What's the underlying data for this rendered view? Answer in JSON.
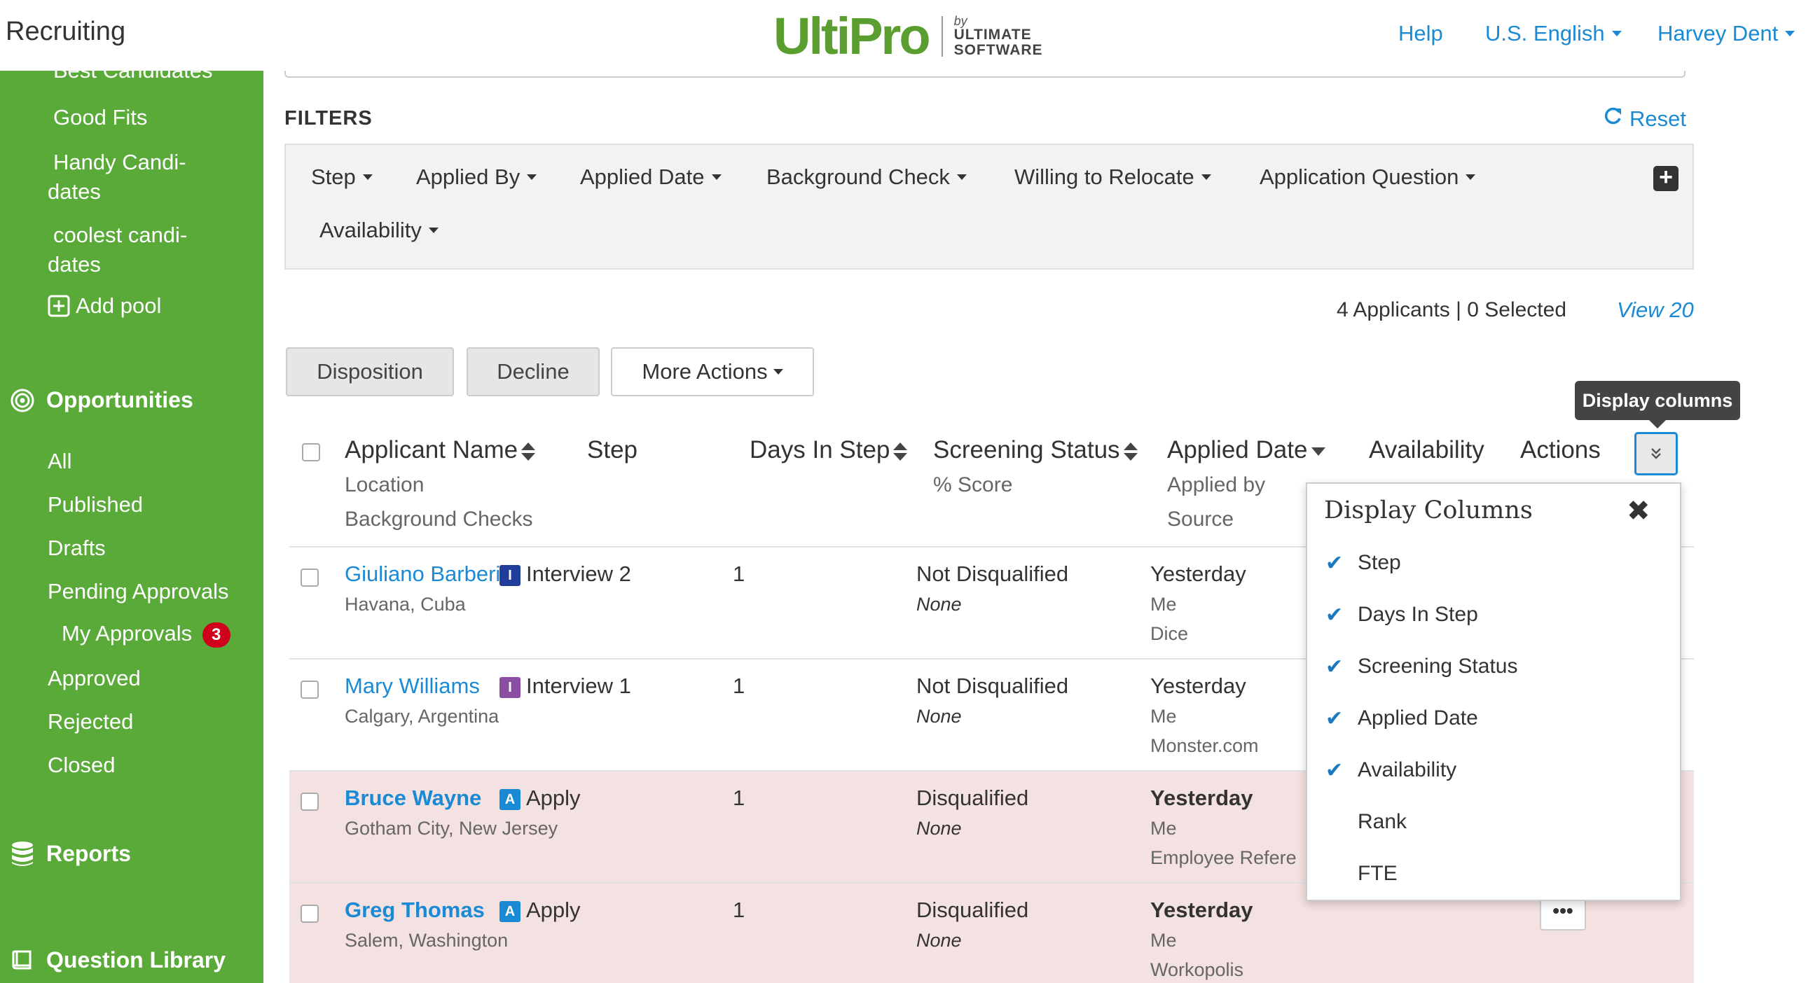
{
  "header": {
    "app_title": "Recruiting",
    "logo_main": "UltiPro",
    "logo_by": "by",
    "logo_company_line1": "ULTIMATE",
    "logo_company_line2": "SOFTWARE",
    "help": "Help",
    "language": "U.S. English",
    "user": "Harvey Dent"
  },
  "sidebar": {
    "pools": [
      {
        "label": "Best Candidates"
      },
      {
        "label": "Good Fits"
      },
      {
        "label_line1": "Handy Candi-",
        "label_line2": "dates"
      },
      {
        "label_line1": "coolest candi-",
        "label_line2": "dates"
      }
    ],
    "add_pool": "Add pool",
    "opportunities_heading": "Opportunities",
    "opportunities": [
      "All",
      "Published",
      "Drafts",
      "Pending Approvals",
      "My Approvals",
      "Approved",
      "Rejected",
      "Closed"
    ],
    "my_approvals_count": "3",
    "reports_heading": "Reports",
    "question_library_heading": "Question Library"
  },
  "filters": {
    "label": "FILTERS",
    "reset": "Reset",
    "items": [
      "Step",
      "Applied By",
      "Applied Date",
      "Background Check",
      "Willing to Relocate",
      "Application Question",
      "Availability"
    ]
  },
  "summary": {
    "count_text": "4 Applicants | 0 Selected",
    "view": "View 20"
  },
  "actions": {
    "disposition": "Disposition",
    "decline": "Decline",
    "more_actions": "More Actions"
  },
  "tooltip": "Display columns",
  "table": {
    "headers": {
      "applicant_name": "Applicant Name",
      "location": "Location",
      "background_checks": "Background Checks",
      "step": "Step",
      "days_in_step": "Days In Step",
      "screening_status": "Screening Status",
      "score": "% Score",
      "applied_date": "Applied Date",
      "applied_by": "Applied by",
      "source": "Source",
      "availability": "Availability",
      "actions": "Actions"
    },
    "rows": [
      {
        "name": "Giuliano Barberi",
        "location": "Havana, Cuba",
        "step_icon": "I",
        "step": "Interview 2",
        "days": "1",
        "status": "Not Disqualified",
        "score": "None",
        "date": "Yesterday",
        "by": "Me",
        "source": "Dice"
      },
      {
        "name": "Mary Williams",
        "location": "Calgary, Argentina",
        "step_icon": "I",
        "step": "Interview 1",
        "days": "1",
        "status": "Not Disqualified",
        "score": "None",
        "date": "Yesterday",
        "by": "Me",
        "source": "Monster.com"
      },
      {
        "name": "Bruce Wayne",
        "location": "Gotham City, New Jersey",
        "step_icon": "A",
        "step": "Apply",
        "days": "1",
        "status": "Disqualified",
        "score": "None",
        "date": "Yesterday",
        "by": "Me",
        "source": "Employee Refere"
      },
      {
        "name": "Greg Thomas",
        "location": "Salem, Washington",
        "step_icon": "A",
        "step": "Apply",
        "days": "1",
        "status": "Disqualified",
        "score": "None",
        "date": "Yesterday",
        "by": "Me",
        "source": "Workopolis"
      }
    ],
    "more_button": "•••"
  },
  "display_columns": {
    "title": "Display Columns",
    "close": "✖",
    "items": [
      {
        "label": "Step",
        "checked": true
      },
      {
        "label": "Days In Step",
        "checked": true
      },
      {
        "label": "Screening Status",
        "checked": true
      },
      {
        "label": "Applied Date",
        "checked": true
      },
      {
        "label": "Availability",
        "checked": true
      },
      {
        "label": "Rank",
        "checked": false
      },
      {
        "label": "FTE",
        "checked": false
      }
    ],
    "check_glyph": "✔"
  },
  "colors": {
    "sidebar_green": "#5aaa3a",
    "link_blue": "#1a8ad4",
    "step_interview2": "#1f3d99",
    "step_interview1": "#8a4fa3",
    "step_apply": "#1a8ad4",
    "disqualified_row": "#f4e1e1"
  }
}
